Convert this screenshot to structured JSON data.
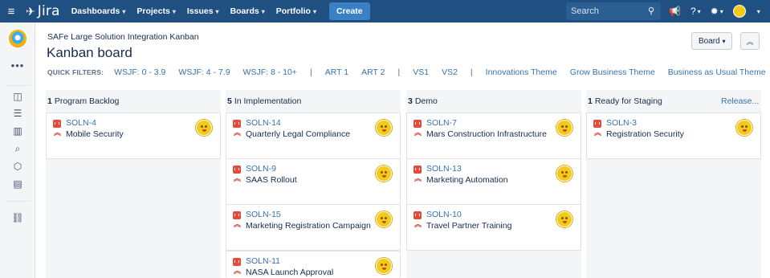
{
  "topnav": {
    "app_name": "Jira",
    "items": [
      {
        "label": "Dashboards",
        "caret": "▾"
      },
      {
        "label": "Projects",
        "caret": "▾"
      },
      {
        "label": "Issues",
        "caret": "▾"
      },
      {
        "label": "Boards",
        "caret": "▾"
      },
      {
        "label": "Portfolio",
        "caret": "▾"
      }
    ],
    "create_label": "Create",
    "search_placeholder": "Search",
    "icons": [
      "app-switcher-icon",
      "jira-logo-icon",
      "search-icon",
      "notifications-icon",
      "help-icon",
      "settings-icon",
      "user-avatar"
    ]
  },
  "sidebar": {
    "icons": [
      "project-avatar",
      "more-icon",
      "board-icon",
      "backlog-icon",
      "reports-icon",
      "issues-icon",
      "components-icon",
      "releases-icon",
      "add-link-icon"
    ]
  },
  "header": {
    "breadcrumb": "SAFe Large Solution Integration Kanban",
    "title": "Kanban board",
    "board_button": "Board",
    "board_caret": "▾"
  },
  "filters": {
    "label": "QUICK FILTERS:",
    "items": [
      "WSJF: 0 - 3.9",
      "WSJF: 4 - 7.9",
      "WSJF: 8 - 10+",
      "|",
      "ART 1",
      "ART 2",
      "|",
      "VS1",
      "VS2",
      "|",
      "Innovations Theme",
      "Grow Business Theme",
      "Business as Usual Theme"
    ]
  },
  "columns": [
    {
      "count": "1",
      "name": "Program Backlog",
      "cards": [
        {
          "key": "SOLN-4",
          "summary": "Mobile Security"
        }
      ]
    },
    {
      "count": "5",
      "name": "In Implementation",
      "cards": [
        {
          "key": "SOLN-14",
          "summary": "Quarterly Legal Compliance"
        },
        {
          "key": "SOLN-9",
          "summary": "SAAS Rollout"
        },
        {
          "key": "SOLN-15",
          "summary": "Marketing Registration Campaign"
        },
        {
          "key": "SOLN-11",
          "summary": "NASA Launch Approval"
        }
      ]
    },
    {
      "count": "3",
      "name": "Demo",
      "cards": [
        {
          "key": "SOLN-7",
          "summary": "Mars Construction Infrastructure"
        },
        {
          "key": "SOLN-13",
          "summary": "Marketing Automation"
        },
        {
          "key": "SOLN-10",
          "summary": "Travel Partner Training"
        }
      ]
    },
    {
      "count": "1",
      "name": "Ready for Staging",
      "cards": [
        {
          "key": "SOLN-3",
          "summary": "Registration Security"
        }
      ]
    }
  ],
  "release_link": "Release...",
  "colors": {
    "nav": "#205081",
    "link": "#3572b0",
    "bug": "#e5493a",
    "priority": "#d04437",
    "column_bg": "#f4f5f7"
  }
}
